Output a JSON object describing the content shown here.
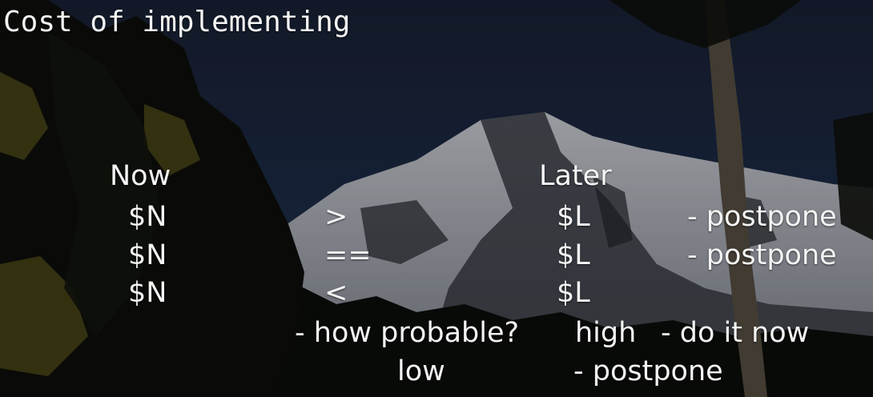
{
  "slide": {
    "title": "Cost of implementing",
    "headers": {
      "now": "Now",
      "later": "Later"
    },
    "rows": [
      {
        "now": "$N",
        "op": ">",
        "later": "$L",
        "action": "- postpone"
      },
      {
        "now": "$N",
        "op": "==",
        "later": "$L",
        "action": "- postpone"
      },
      {
        "now": "$N",
        "op": "<",
        "later": "$L",
        "action": ""
      }
    ],
    "probability": {
      "question": "- how probable?",
      "high_label": "high",
      "high_action": "- do it now",
      "low_label": "low",
      "low_action": "- postpone"
    }
  },
  "colors": {
    "text": "#f4f4f4",
    "sky": "#1c2a44",
    "snow": "#c9ccd4",
    "rock": "#2b2d33",
    "foliage_dark": "#0d0f0c",
    "foliage_gold": "#6f6520"
  }
}
